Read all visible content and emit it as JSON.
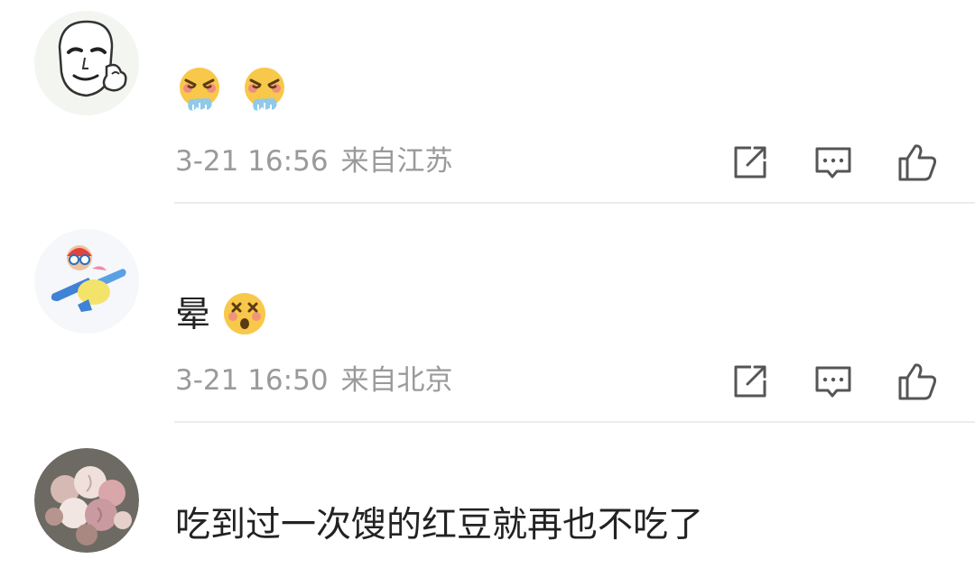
{
  "comments": [
    {
      "avatar": "meme-face-avatar-icon",
      "text": "",
      "emojis": [
        "steam-from-nose-face-icon",
        "steam-from-nose-face-icon"
      ],
      "time": "3-21 16:56",
      "location": "来自江苏",
      "actions": [
        "share-icon",
        "reply-icon",
        "like-icon"
      ]
    },
    {
      "avatar": "cartoon-airplane-avatar-icon",
      "text": "晕",
      "emojis": [
        "dizzy-face-icon"
      ],
      "time": "3-21 16:50",
      "location": "来自北京",
      "actions": [
        "share-icon",
        "reply-icon",
        "like-icon"
      ]
    },
    {
      "avatar": "flower-bouquet-avatar-icon",
      "text": "吃到过一次馊的红豆就再也不吃了",
      "emojis": [],
      "time": "",
      "location": "",
      "actions": []
    }
  ],
  "colors": {
    "text": "#222222",
    "meta": "#9a9a9a",
    "icon": "#555555",
    "divider": "#ececec",
    "emoji_face": "#f7c84a",
    "emoji_blush": "#ef7d8c",
    "steam": "#8fc9ec"
  }
}
